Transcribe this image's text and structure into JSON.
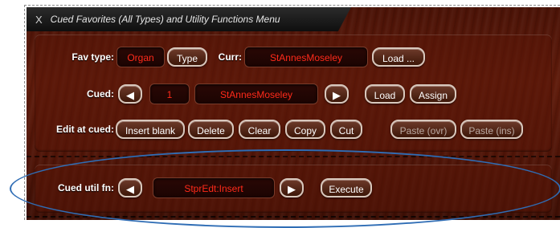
{
  "window": {
    "close_glyph": "X",
    "title": "Cued Favorites (All Types) and Utility Functions Menu"
  },
  "row_fav": {
    "label": "Fav type:",
    "type_value": "Organ",
    "type_button": "Type",
    "curr_label": "Curr:",
    "curr_value": "StAnnesMoseley",
    "load_button": "Load ..."
  },
  "row_cued": {
    "label": "Cued:",
    "prev_glyph": "◀",
    "index_value": "1",
    "name_value": "StAnnesMoseley",
    "next_glyph": "▶",
    "load_button": "Load",
    "assign_button": "Assign"
  },
  "row_edit": {
    "label": "Edit at cued:",
    "buttons": [
      "Insert blank",
      "Delete",
      "Clear",
      "Copy",
      "Cut",
      "Paste (ovr)",
      "Paste (ins)"
    ]
  },
  "row_util": {
    "label": "Cued util fn:",
    "prev_glyph": "◀",
    "value": "StprEdt:Insert",
    "next_glyph": "▶",
    "execute_button": "Execute"
  },
  "colors": {
    "display_text": "#ff2a1a",
    "highlight_ellipse": "#2f6db5"
  }
}
